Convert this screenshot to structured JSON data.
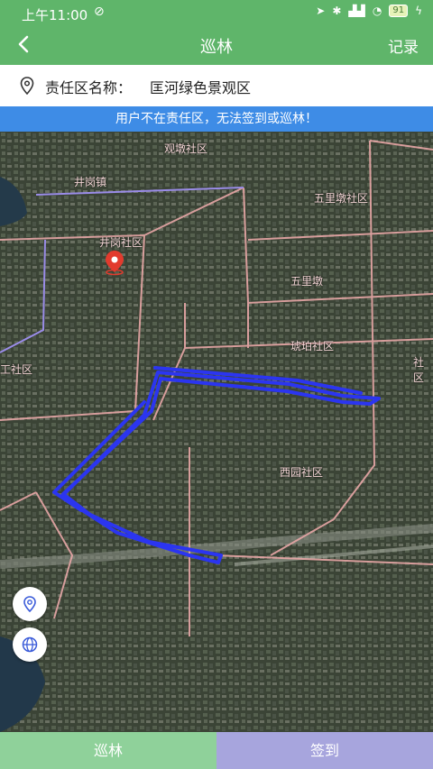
{
  "status": {
    "time": "上午11:00",
    "battery": "91"
  },
  "header": {
    "title": "巡林",
    "record": "记录"
  },
  "area": {
    "label": "责任区名称：",
    "value": "匡河绿色景观区"
  },
  "warning": "用户不在责任区，无法签到或巡林！",
  "map_labels": {
    "l1": "观墩社区",
    "l2": "井岗镇",
    "l3": "五里墩社区",
    "l4": "井岗社区",
    "l5": "五里墩",
    "l6": "琥珀社区",
    "l7": "西园社区",
    "l8": "工社区",
    "l9": "社区"
  },
  "tabs": {
    "patrol": "巡林",
    "signin": "签到"
  },
  "colors": {
    "primary": "#5fb56a",
    "warning": "#3e8ce6",
    "route": "#2b35f0"
  }
}
